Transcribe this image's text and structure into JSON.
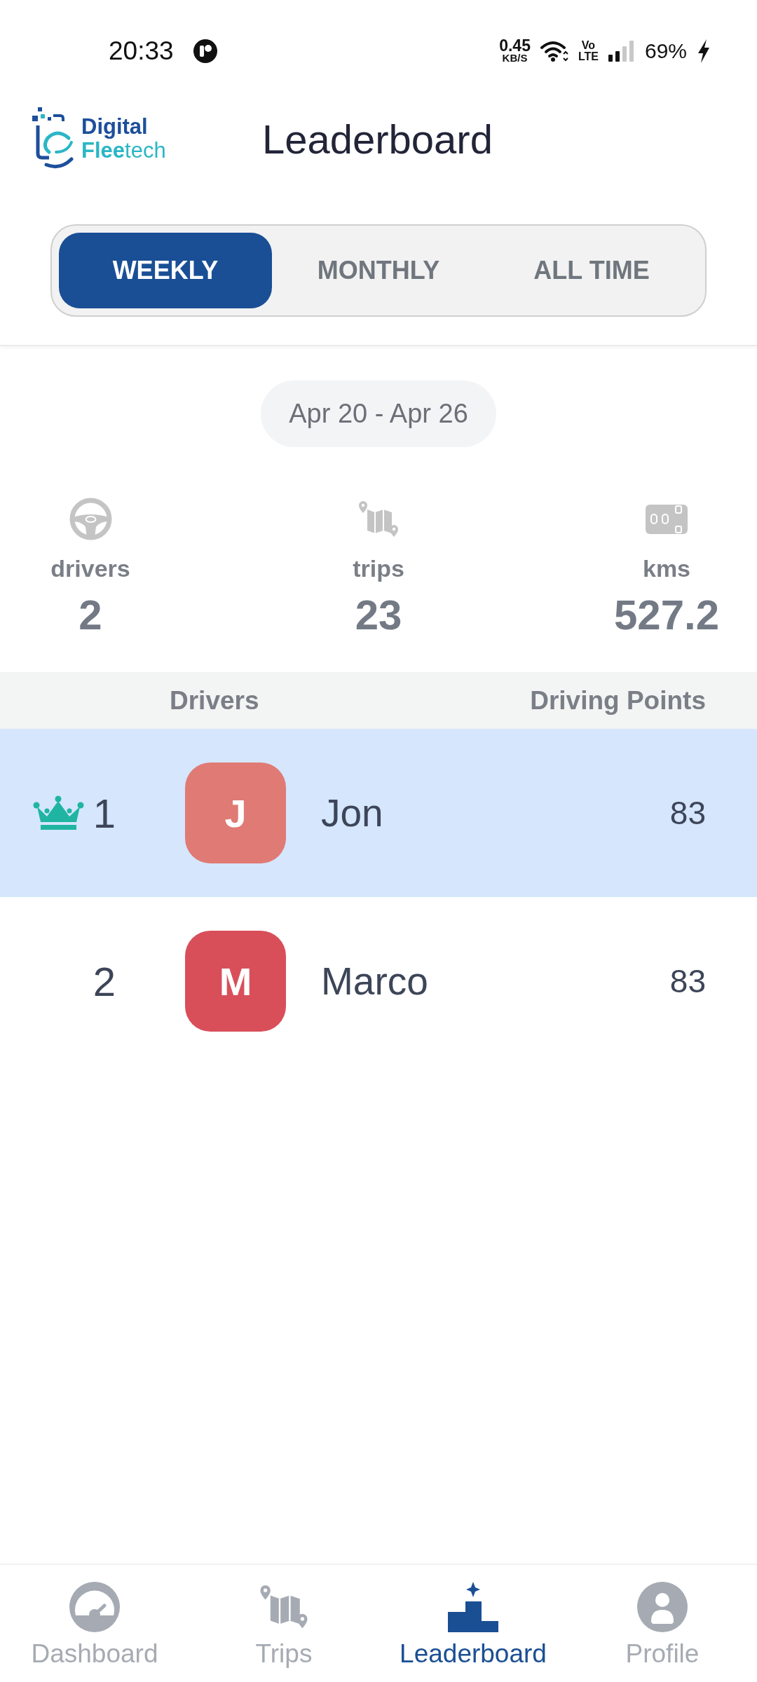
{
  "status_bar": {
    "time": "20:33",
    "net_speed": "0.45",
    "net_unit": "KB/S",
    "volte_top": "Vo",
    "volte_bottom": "LTE",
    "battery": "69%",
    "charging": true
  },
  "header": {
    "logo_top": "Digital",
    "logo_bottom": "**Flee**tech",
    "title": "Leaderboard"
  },
  "tabs": [
    {
      "label": "WEEKLY",
      "selected": true
    },
    {
      "label": "MONTHLY",
      "selected": false
    },
    {
      "label": "ALL TIME",
      "selected": false
    }
  ],
  "date_range": "Apr 20 - Apr 26",
  "stats": [
    {
      "kind": "steering",
      "label": "drivers",
      "value": "2"
    },
    {
      "kind": "map",
      "label": "trips",
      "value": "23"
    },
    {
      "kind": "odometer",
      "label": "kms",
      "value": "527.2"
    }
  ],
  "table": {
    "columns": [
      "Drivers",
      "Driving Points"
    ],
    "rows": [
      {
        "rank": "1",
        "crown": true,
        "initial": "J",
        "color": "#e07a74",
        "name": "Jon",
        "points": "83",
        "highlighted": true
      },
      {
        "rank": "2",
        "crown": false,
        "initial": "M",
        "color": "#d84f5a",
        "name": "Marco",
        "points": "83",
        "highlighted": false
      }
    ]
  },
  "bottom_nav": [
    {
      "kind": "dashboard",
      "label": "Dashboard",
      "selected": false
    },
    {
      "kind": "trips",
      "label": "Trips",
      "selected": false
    },
    {
      "kind": "leaderboard",
      "label": "Leaderboard",
      "selected": true
    },
    {
      "kind": "profile",
      "label": "Profile",
      "selected": false
    }
  ]
}
